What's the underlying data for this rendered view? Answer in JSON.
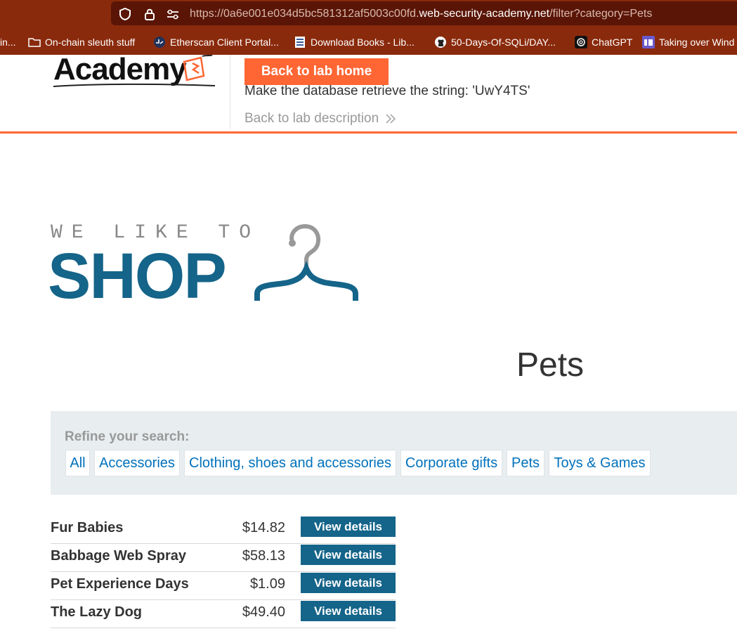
{
  "browser": {
    "url_prefix": "https://0a6e001e034d5bc581312af5003c00fd.",
    "url_domain": "web-security-academy.net",
    "url_path": "/filter?category=Pets",
    "bookmarks": [
      {
        "label": "in...",
        "icon": "none"
      },
      {
        "label": "On-chain sleuth stuff",
        "icon": "folder-icon"
      },
      {
        "label": "Etherscan Client Portal...",
        "icon": "etherscan-icon"
      },
      {
        "label": "Download Books - Lib...",
        "icon": "library-icon"
      },
      {
        "label": "50-Days-Of-SQLi/DAY...",
        "icon": "github-icon"
      },
      {
        "label": "ChatGPT",
        "icon": "chatgpt-icon"
      },
      {
        "label": "Taking over Wind",
        "icon": "bookmark-icon"
      }
    ]
  },
  "lab": {
    "logo_text": "Academy",
    "back_to_lab_home": "Back to lab home",
    "objective": "Make the database retrieve the string: 'UwY4TS'",
    "back_to_description": "Back to lab description"
  },
  "shop": {
    "tagline": "WE LIKE TO",
    "shop_word": "SHOP",
    "page_title": "Pets"
  },
  "filters": {
    "refine_label": "Refine your search:",
    "categories": [
      "All",
      "Accessories",
      "Clothing, shoes and accessories",
      "Corporate gifts",
      "Pets",
      "Toys & Games"
    ]
  },
  "products": [
    {
      "name": "Fur Babies",
      "price": "$14.82",
      "action": "View details"
    },
    {
      "name": "Babbage Web Spray",
      "price": "$58.13",
      "action": "View details"
    },
    {
      "name": "Pet Experience Days",
      "price": "$1.09",
      "action": "View details"
    },
    {
      "name": "The Lazy Dog",
      "price": "$49.40",
      "action": "View details"
    }
  ],
  "colors": {
    "accent_orange": "#ff6633",
    "brand_blue": "#156489",
    "link_blue": "#0071bc"
  }
}
